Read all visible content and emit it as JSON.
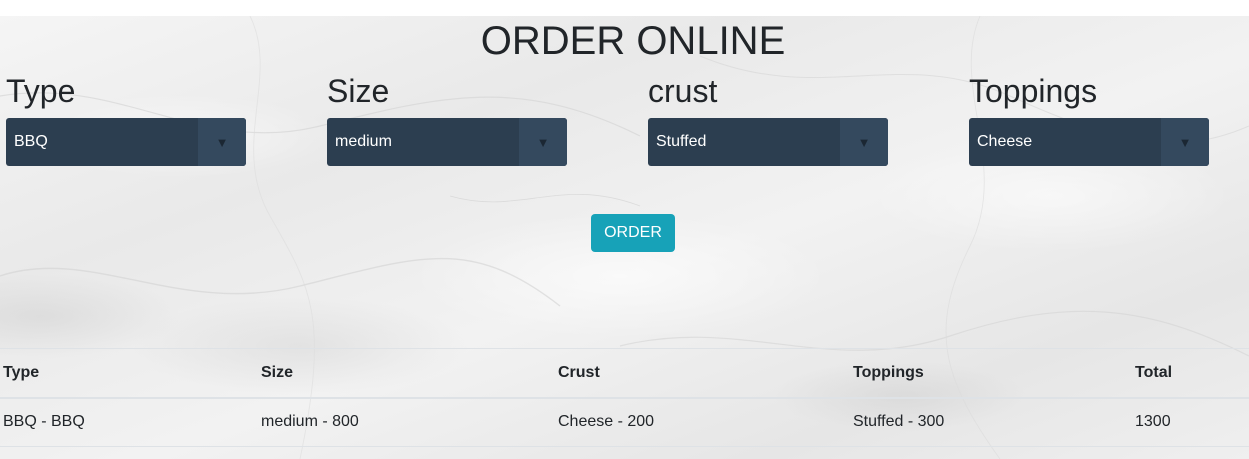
{
  "page": {
    "title": "ORDER ONLINE"
  },
  "form": {
    "fields": [
      {
        "label": "Type",
        "value": "BBQ"
      },
      {
        "label": "Size",
        "value": "medium"
      },
      {
        "label": "crust",
        "value": "Stuffed"
      },
      {
        "label": "Toppings",
        "value": "Cheese"
      }
    ],
    "dropdown_icon": "triangle-down",
    "order_button": "ORDER"
  },
  "table": {
    "headers": [
      "Type",
      "Size",
      "Crust",
      "Toppings",
      "Total"
    ],
    "rows": [
      [
        "BBQ - BBQ",
        "medium - 800",
        "Cheese - 200",
        "Stuffed - 300",
        "1300"
      ]
    ]
  },
  "colors": {
    "select_bg": "#2c3e50",
    "select_arrow_bg": "#34495e",
    "order_button_bg": "#17a2b8",
    "text": "#212529"
  }
}
